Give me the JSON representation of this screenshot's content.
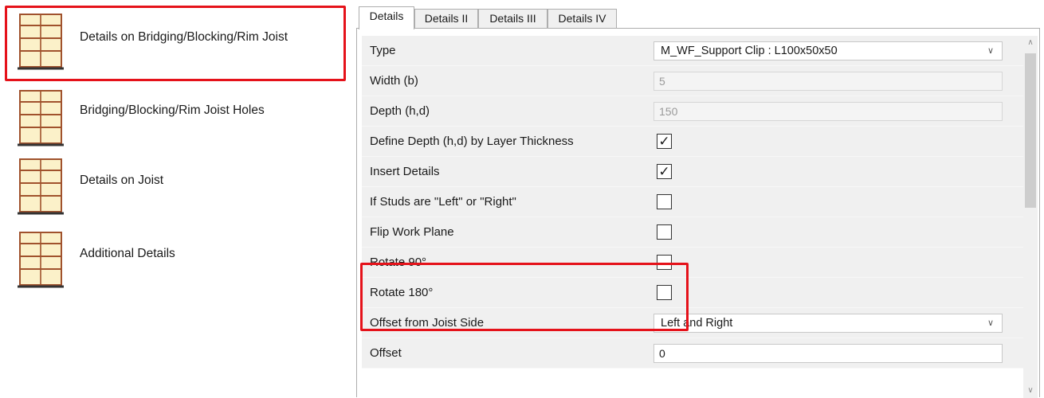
{
  "categories": [
    {
      "label": "Details on Bridging/Blocking/Rim Joist",
      "icon": "framing-grid-icon",
      "selected": true
    },
    {
      "label": "Bridging/Blocking/Rim Joist Holes",
      "icon": "framing-grid-icon"
    },
    {
      "label": "Details on Joist",
      "icon": "framing-grid-icon"
    },
    {
      "label": "Additional Details",
      "icon": "framing-grid-icon"
    }
  ],
  "tabs": [
    {
      "label": "Details",
      "active": true
    },
    {
      "label": "Details II"
    },
    {
      "label": "Details III"
    },
    {
      "label": "Details IV"
    }
  ],
  "properties": [
    {
      "name": "Type",
      "control": "combo",
      "value": "M_WF_Support Clip : L100x50x50"
    },
    {
      "name": "Width (b)",
      "control": "text-disabled",
      "value": "5"
    },
    {
      "name": "Depth (h,d)",
      "control": "text-disabled",
      "value": "150"
    },
    {
      "name": "Define Depth (h,d) by Layer Thickness",
      "control": "checkbox",
      "checked": true,
      "mark": "✓"
    },
    {
      "name": "Insert Details",
      "control": "checkbox",
      "checked": true,
      "mark": "✓"
    },
    {
      "name": "If Studs are \"Left\" or \"Right\"",
      "control": "checkbox",
      "checked": false,
      "mark": ""
    },
    {
      "name": "Flip Work Plane",
      "control": "checkbox",
      "checked": false,
      "mark": ""
    },
    {
      "name": "Rotate 90°",
      "control": "checkbox",
      "checked": false,
      "mark": ""
    },
    {
      "name": "Rotate 180°",
      "control": "checkbox",
      "checked": false,
      "mark": ""
    },
    {
      "name": "Offset from Joist Side",
      "control": "combo",
      "value": "Left and Right"
    },
    {
      "name": "Offset",
      "control": "text",
      "value": "0"
    }
  ],
  "colors": {
    "highlight": "#e5121a",
    "grid_row": "#f0f0f0"
  }
}
